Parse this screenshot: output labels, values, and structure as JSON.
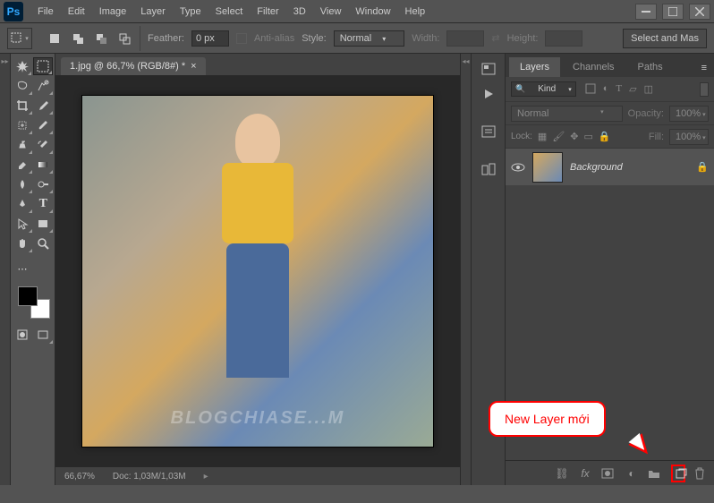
{
  "app": {
    "logo_text": "Ps"
  },
  "menu": [
    "File",
    "Edit",
    "Image",
    "Layer",
    "Type",
    "Select",
    "Filter",
    "3D",
    "View",
    "Window",
    "Help"
  ],
  "options": {
    "feather_label": "Feather:",
    "feather_value": "0 px",
    "antialias_label": "Anti-alias",
    "style_label": "Style:",
    "style_value": "Normal",
    "width_label": "Width:",
    "height_label": "Height:",
    "select_mask": "Select and Mas"
  },
  "document": {
    "tab_title": "1.jpg @ 66,7% (RGB/8#) *",
    "zoom": "66,67%",
    "doc_info": "Doc: 1,03M/1,03M",
    "watermark": "BLOGCHIASE...M"
  },
  "panels": {
    "tabs": [
      "Layers",
      "Channels",
      "Paths"
    ],
    "filter_kind": "Kind",
    "blend_mode": "Normal",
    "opacity_label": "Opacity:",
    "opacity_value": "100%",
    "lock_label": "Lock:",
    "fill_label": "Fill:",
    "fill_value": "100%",
    "layers": [
      {
        "name": "Background",
        "locked": true,
        "visible": true
      }
    ]
  },
  "callout": {
    "text": "New Layer mới"
  },
  "strip_labels": [
    "",
    "",
    ""
  ]
}
